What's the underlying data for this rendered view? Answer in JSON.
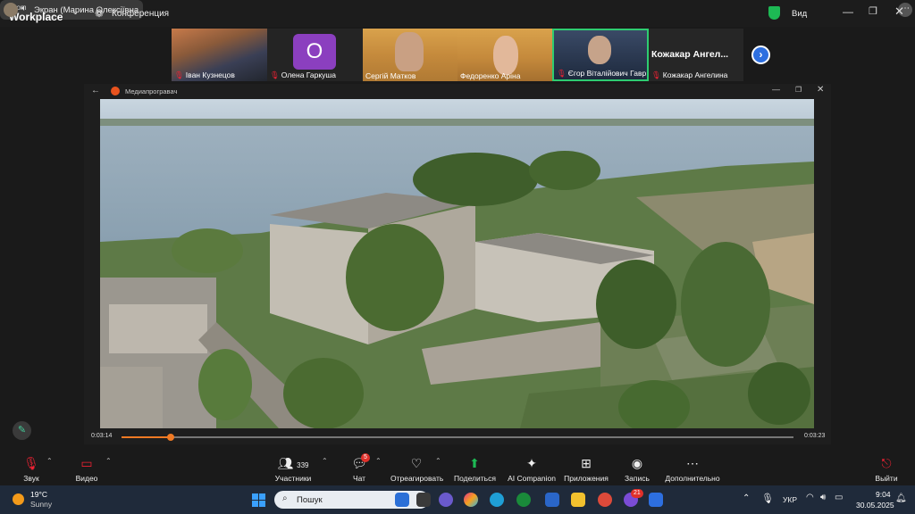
{
  "app": {
    "logo_line1": "zoom",
    "logo_line2": "Workplace",
    "meeting_label": "Конференция",
    "share_text": "Экран (Марина Олексіївна",
    "view_label": "Вид",
    "shield_color": "#1db954"
  },
  "participants": [
    {
      "name": "Іван Кузнецов",
      "muted": true
    },
    {
      "name": "Олена Гаркуша",
      "muted": true,
      "initial": "О"
    },
    {
      "name": "Сергій Матков",
      "muted": false
    },
    {
      "name": "Федоренко Аріна",
      "muted": true
    },
    {
      "name": "Єгор Віталійович Гавр...",
      "muted": true,
      "active_speaker": true
    },
    {
      "name": "Кожакар Ангелина",
      "muted": true,
      "title": "Кожакар Ангел..."
    }
  ],
  "media_player": {
    "title": "Медиапрогравач",
    "time_current": "0:03:14",
    "time_total": "0:03:23",
    "progress": 0.073,
    "accent": "#f07a24"
  },
  "toolbar": {
    "audio": "Звук",
    "video": "Видео",
    "participants": "Участники",
    "participants_count": "339",
    "chat": "Чат",
    "chat_badge": "5",
    "react": "Отреагировать",
    "share": "Поделиться",
    "ai": "AI Companion",
    "apps": "Приложения",
    "record": "Запись",
    "more": "Дополнительно",
    "leave": "Выйти"
  },
  "taskbar": {
    "temp": "19°C",
    "condition": "Sunny",
    "search_placeholder": "Пошук",
    "lang": "УКР",
    "time": "9:04",
    "date": "30.05.2025",
    "badge_count": "21"
  }
}
